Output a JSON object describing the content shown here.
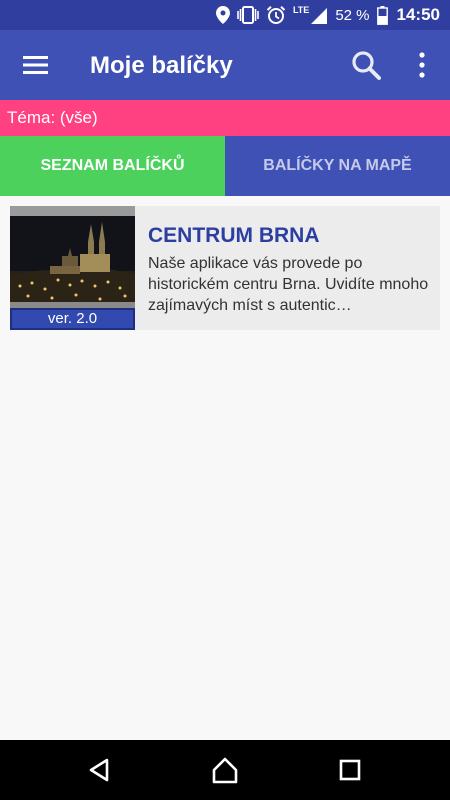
{
  "status_bar": {
    "network": "LTE",
    "battery": "52 %",
    "time": "14:50"
  },
  "app_bar": {
    "title": "Moje balíčky",
    "menu_icon": "hamburger-icon",
    "search_icon": "search-icon",
    "more_icon": "more-vert-icon"
  },
  "topic_filter": {
    "label": "Téma: (vše)"
  },
  "tabs": [
    {
      "label": "SEZNAM BALÍČKŮ",
      "active": true,
      "color": "#4cd15c"
    },
    {
      "label": "BALÍČKY NA MAPĚ",
      "active": false,
      "color": "#3f51b5"
    }
  ],
  "packages": [
    {
      "title": "CENTRUM BRNA",
      "description": "Naše aplikace vás provede po historickém centru Brna.  Uvidíte mnoho zajímavých míst s autentic…",
      "version": "ver. 2.0"
    }
  ],
  "nav_bar": {
    "back_icon": "back-icon",
    "home_icon": "home-icon",
    "recents_icon": "recents-icon"
  },
  "colors": {
    "primary": "#3f51b5",
    "primary_dark": "#303f9f",
    "accent": "#ff4081",
    "active_tab": "#4cd15c",
    "package_title": "#2c3ea0"
  }
}
